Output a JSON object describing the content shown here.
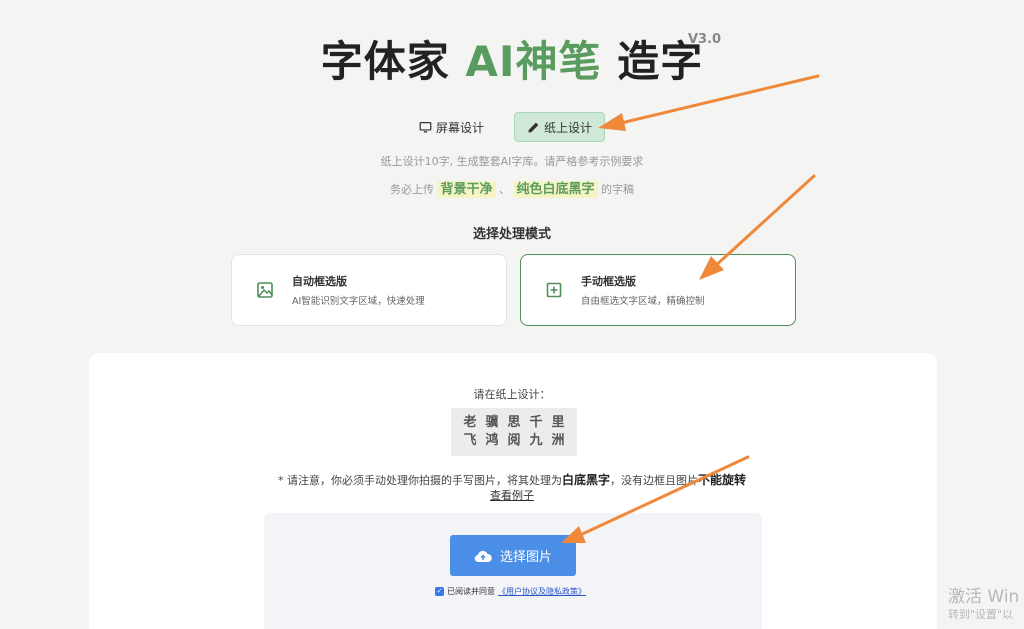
{
  "header": {
    "title_prefix": "字体家",
    "title_ai": "AI神笔",
    "title_suffix": "造字",
    "version": "V3.0"
  },
  "tabs": [
    {
      "label": "屏幕设计",
      "icon": "monitor-icon",
      "active": false
    },
    {
      "label": "纸上设计",
      "icon": "pencil-icon",
      "active": true
    }
  ],
  "description": {
    "line1": "纸上设计10字, 生成整套AI字库。请严格参考示例要求",
    "line2_prefix": "务必上传",
    "highlight1": "背景干净",
    "separator": "、",
    "highlight2": "纯色白底黑字",
    "line2_suffix": "的字稿"
  },
  "mode_section": {
    "title": "选择处理模式",
    "modes": [
      {
        "name": "自动框选版",
        "desc": "AI智能识别文字区域，快速处理",
        "icon": "image-icon",
        "selected": false
      },
      {
        "name": "手动框选版",
        "desc": "自由框选文字区域，精确控制",
        "icon": "plus-square-icon",
        "selected": true
      }
    ]
  },
  "upload_panel": {
    "prompt": "请在纸上设计：",
    "chars_row1": [
      "老",
      "骥",
      "思",
      "千",
      "里"
    ],
    "chars_row2": [
      "飞",
      "鸿",
      "阅",
      "九",
      "洲"
    ],
    "note_prefix": "* 请注意，你必须手动处理你拍摄的手写图片，将其处理为",
    "note_bold1": "白底黑字",
    "note_mid": "，没有边框且图片",
    "note_bold2": "不能旋转",
    "example_link": "查看例子",
    "upload_button": "选择图片",
    "agree_text": "已阅读并同意",
    "agree_link": "《用户协议及隐私政策》",
    "agree_checked": true
  },
  "watermark": {
    "line1": "激活 Win",
    "line2": "转到\"设置\"以"
  },
  "colors": {
    "accent_green": "#5a9b5f",
    "upload_blue": "#4a8ee8",
    "arrow_orange": "#f0883a"
  }
}
